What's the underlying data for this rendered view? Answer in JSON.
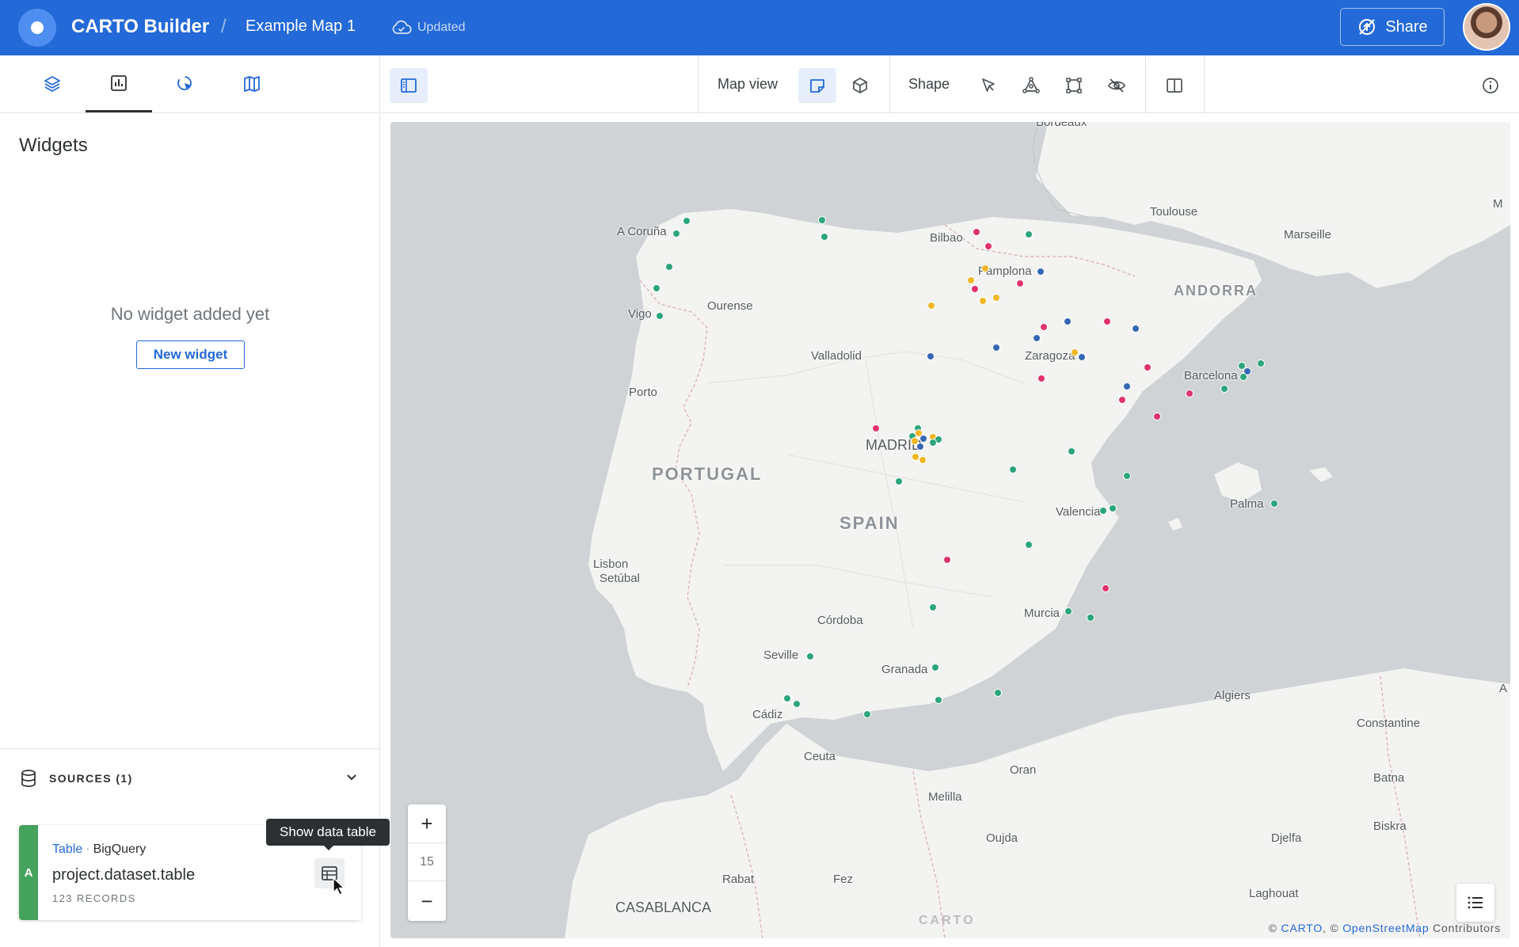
{
  "header": {
    "app_title": "CARTO Builder",
    "separator": "/",
    "map_name": "Example Map 1",
    "status": "Updated",
    "share_label": "Share",
    "colors": {
      "bar": "#2369d7"
    }
  },
  "left_panel": {
    "tabs": [
      {
        "icon": "layers-icon",
        "active": false
      },
      {
        "icon": "widgets-chart-icon",
        "active": true
      },
      {
        "icon": "interactions-icon",
        "active": false
      },
      {
        "icon": "basemap-icon",
        "active": false
      }
    ],
    "widgets_title": "Widgets",
    "empty_message": "No widget added yet",
    "new_widget_label": "New widget",
    "sources": {
      "label": "SOURCES (1)",
      "items": [
        {
          "badge": "A",
          "kind": "Table",
          "connector": "BigQuery",
          "name": "project.dataset.table",
          "records": "123 RECORDS",
          "action_tooltip": "Show data table"
        }
      ]
    }
  },
  "toolbar": {
    "map_view_label": "Map view",
    "shape_label": "Shape"
  },
  "map": {
    "zoom_level": "15",
    "zoom_in": "+",
    "zoom_out": "−",
    "attribution": {
      "prefix": "© ",
      "carto": "CARTO",
      "middle": ", © ",
      "osm": "OpenStreetMap",
      "suffix": " Contributors"
    },
    "watermark": "CARTO",
    "labels": {
      "bordeaux": "Bordeaux",
      "toulouse": "Toulouse",
      "marseille": "Marseille",
      "m": "M",
      "acoruna": "A Coruña",
      "bilbao": "Bilbao",
      "pamplona": "Pamplona",
      "andorra": "ANDORRA",
      "ourense": "Ourense",
      "vigo": "Vigo",
      "valladolid": "Valladolid",
      "zaragoza": "Zaragoza",
      "barcelona": "Barcelona",
      "porto": "Porto",
      "madrid": "MADRID",
      "portugal": "PORTUGAL",
      "spain": "SPAIN",
      "valencia": "Valencia",
      "palma": "Palma",
      "lisbon": "Lisbon",
      "setubal": "Setúbal",
      "cordoba": "Córdoba",
      "murcia": "Murcia",
      "seville": "Seville",
      "granada": "Granada",
      "cadiz": "Cádiz",
      "algiers": "Algiers",
      "a": "A",
      "constantine": "Constantine",
      "ceuta": "Ceuta",
      "oran": "Oran",
      "batna": "Batna",
      "melilla": "Melilla",
      "biskra": "Biskra",
      "oujda": "Oujda",
      "djelfa": "Djelfa",
      "rabat": "Rabat",
      "fez": "Fez",
      "laghouat": "Laghouat",
      "casablanca": "CASABLANCA"
    },
    "point_colors": {
      "green": "#2ca57b",
      "pink": "#e0336e",
      "blue": "#3567b4",
      "yellow": "#f2b724"
    }
  }
}
